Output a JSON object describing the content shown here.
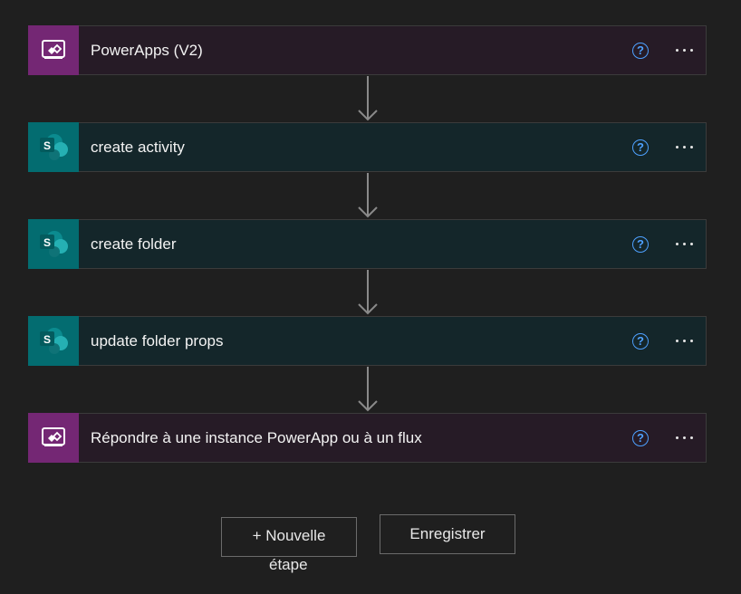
{
  "steps": [
    {
      "title": "PowerApps (V2)",
      "kind": "powerapps",
      "color": "#742774"
    },
    {
      "title": "create activity",
      "kind": "sharepoint",
      "color": "#036c70"
    },
    {
      "title": "create folder",
      "kind": "sharepoint",
      "color": "#036c70"
    },
    {
      "title": "update folder props",
      "kind": "sharepoint",
      "color": "#036c70"
    },
    {
      "title": "Répondre à une instance PowerApp ou à un flux",
      "kind": "powerapps",
      "color": "#742774"
    }
  ],
  "help_glyph": "?",
  "actions": {
    "new_step_label_line1": "+ Nouvelle",
    "new_step_label_line2": "étape",
    "save_label": "Enregistrer"
  },
  "icons": {
    "powerapps": "powerapps-icon",
    "sharepoint": "sharepoint-icon",
    "help": "help-icon",
    "more": "more-options-icon",
    "arrow": "arrow-down-icon"
  }
}
